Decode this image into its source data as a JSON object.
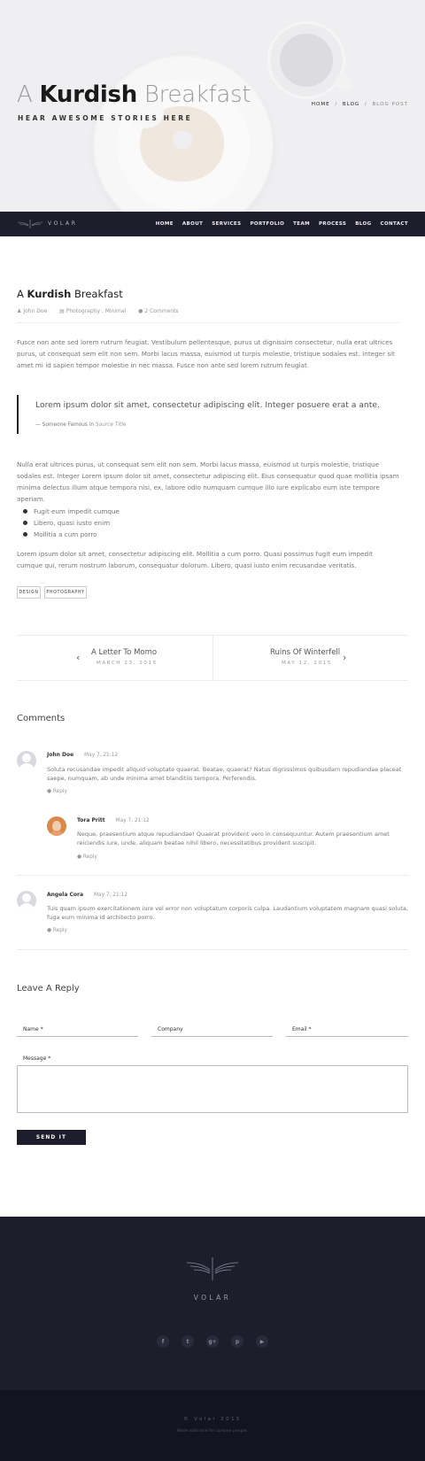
{
  "hero": {
    "title_light": "A",
    "title_bold": "Kurdish",
    "title_rest": "Breakfast",
    "subtitle": "HEAR AWESOME STORIES HERE",
    "breadcrumb": [
      "HOME",
      "BLOG",
      "BLOG POST"
    ],
    "breadcrumb_sep": "/"
  },
  "nav": {
    "logo_text": "VOLAR",
    "items": [
      "HOME",
      "ABOUT",
      "SERVICES",
      "PORTFOLIO",
      "TEAM",
      "PROCESS",
      "BLOG",
      "CONTACT"
    ]
  },
  "post": {
    "title_light": "A",
    "title_bold": "Kurdish",
    "title_rest": "Breakfast",
    "author": "John Doe",
    "categories": "Photography , Minimal",
    "comments_count": "2 Comments",
    "para1": "Fusce non ante sed lorem rutrum feugiat. Vestibulum pellentesque, purus ut dignissim consectetur, nulla erat ultrices purus, ut consequat sem elit non sem. Morbi lacus massa, euismod ut turpis molestie, tristique sodales est. Integer sit amet mi id sapien tempor molestie in nec massa. Fusce non ante sed lorem rutrum feugiat.",
    "quote": "Lorem ipsum dolor sit amet, consectetur adipiscing elit. Integer posuere erat a ante.",
    "quote_cite_prefix": "— Someone Famous in",
    "quote_cite_source": "Source Title",
    "para2": "Nulla erat ultrices purus, ut consequat sem elit non sem. Morbi lacus massa, euismod ut turpis molestie, tristique sodales est. Integer Lorem ipsum dolor sit amet, consectetur adipiscing elit. Eius consequatur quod quae mollitia ipsam minima delectus illum atque tempora nisi, ex, labore odio numquam cumque illo iure explicabo eum iste tempore aperiam.",
    "bullets": [
      "Fugit eum impedit cumque",
      "Libero, quasi iusto enim",
      "Mollitia a cum porro"
    ],
    "para3": "Lorem ipsum dolor sit amet, consectetur adipiscing elit. Mollitia a cum porro. Quasi possimus fugit eum impedit cumque qui, rerum nostrum laborum, consequatur dolorum. Libero, quasi iusto enim recusandae veritatis.",
    "tags": [
      "DESIGN",
      "PHOTOGRAPHY"
    ]
  },
  "pager": {
    "prev_title": "A Letter To Momo",
    "prev_date": "MARCH 23, 2015",
    "next_title": "Ruins Of Winterfell",
    "next_date": "MAY 12, 2015"
  },
  "comments": {
    "heading": "Comments",
    "reply_label": "Reply",
    "items": [
      {
        "name": "John Doe",
        "date": "May 7, 21:12",
        "text": "Soluta recusandae impedit aliquid voluptate quaerat. Beatae, quaerat? Natus dignissimos quibusdam repudiandae placeat saepe, numquam, ab unde minima amet blanditiis tempora. Perferendis."
      },
      {
        "name": "Tora Pritt",
        "date": "May 7, 21:12",
        "text": "Neque, praesentium atque repudiandae! Quaerat provident vero in consequuntur. Autem praesentium amet reiciendis iure, unde, aliquam beatae nihil libero, necessitatibus provident suscipit."
      },
      {
        "name": "Angela Cora",
        "date": "May 7, 21:12",
        "text": "Tuis quam ipsum exercitationem iure vel error non voluptatum corporis culpa. Laudantium voluptatem magnam quasi soluta, fuga eum minima id architecto porro."
      }
    ]
  },
  "reply_form": {
    "heading": "Leave A Reply",
    "name_label": "Name *",
    "company_label": "Company",
    "email_label": "Email *",
    "message_label": "Message *",
    "submit": "SEND IT"
  },
  "footer": {
    "logo_text": "VOLAR",
    "social": [
      "facebook-icon",
      "twitter-icon",
      "google-plus-icon",
      "pinterest-icon",
      "youtube-icon"
    ],
    "copyright": "© Volar 2015",
    "made_with": "Made with love for aurome people."
  }
}
